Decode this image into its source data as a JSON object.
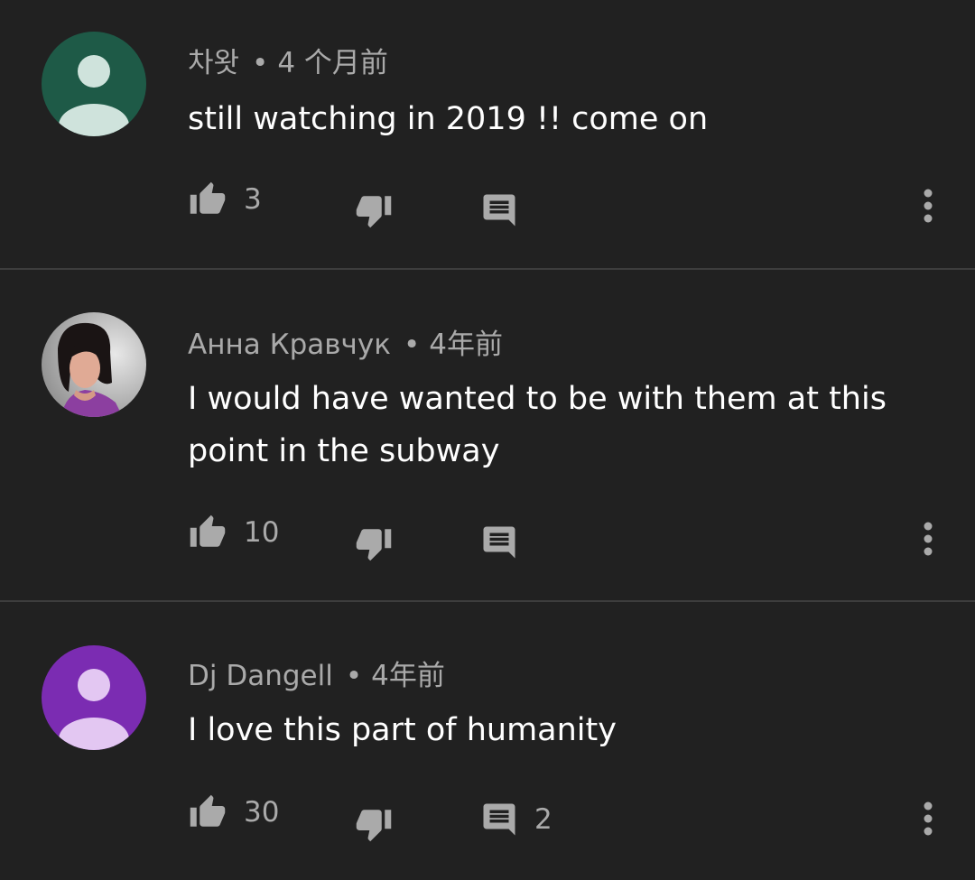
{
  "colors": {
    "background": "#212121",
    "divider": "#3d3d3d",
    "meta_text": "#aaaaaa",
    "body_text": "#ffffff",
    "icon": "#aaaaaa"
  },
  "comments": [
    {
      "author": "차왓",
      "time": "4 个月前",
      "text": "still watching in 2019 !! come on",
      "likes": "3",
      "replies": "",
      "avatar": {
        "type": "default",
        "bg": "#1e5a47",
        "fg": "#cfe3dc"
      }
    },
    {
      "author": "Анна Кравчук",
      "time": "4年前",
      "text": "I would have wanted to be with them at this point in the subway",
      "likes": "10",
      "replies": "",
      "avatar": {
        "type": "photo"
      }
    },
    {
      "author": "Dj Dangell",
      "time": "4年前",
      "text": "I love this part of humanity",
      "likes": "30",
      "replies": "2",
      "avatar": {
        "type": "default",
        "bg": "#7b2cb2",
        "fg": "#e3c7f2"
      }
    }
  ],
  "separator": "•",
  "icons": {
    "like": "thumb-up-icon",
    "dislike": "thumb-down-icon",
    "reply": "comment-icon",
    "more": "more-vertical-icon"
  }
}
